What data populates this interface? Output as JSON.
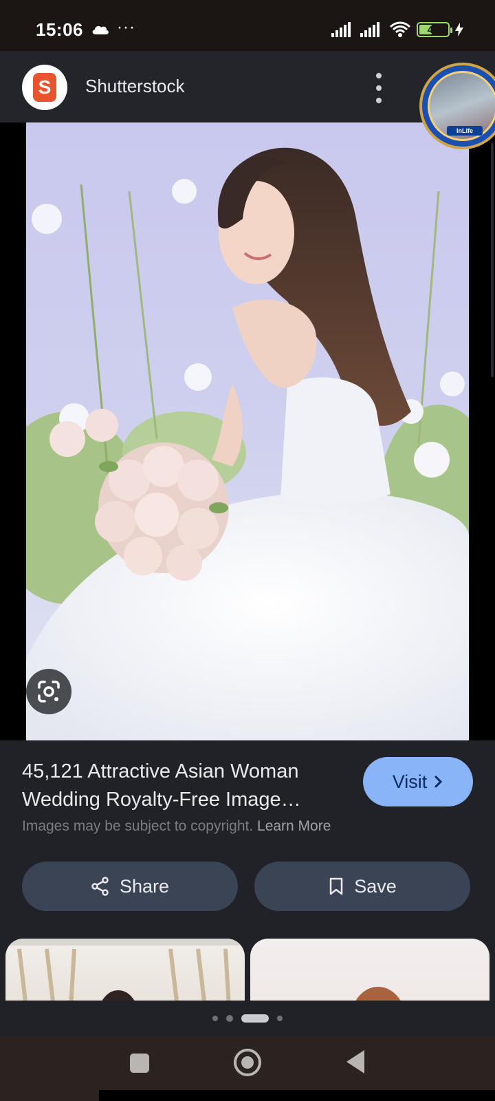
{
  "status_bar": {
    "time": "15:06",
    "more": "···",
    "battery": "42",
    "icons": [
      "cloud-icon",
      "signal-icon",
      "signal-icon",
      "wifi-icon",
      "battery-icon",
      "charging-icon"
    ]
  },
  "header": {
    "site_name": "Shutterstock",
    "logo_glyph": "S",
    "menu_icon": "more-vert-icon"
  },
  "floating_bubble": {
    "badge_text": "InLife"
  },
  "image": {
    "lens_icon": "google-lens-icon"
  },
  "result": {
    "title": "45,121 Attractive Asian Woman Wedding Royalty-Free Image…",
    "visit_label": "Visit",
    "copyright_text": "Images may be subject to copyright.",
    "learn_more_label": "Learn More",
    "share_label": "Share",
    "save_label": "Save"
  },
  "pager": {
    "dots": 4,
    "active_index": 2
  },
  "colors": {
    "accent": "#8ab4f8",
    "button_bg": "#3a4455",
    "background": "#202227",
    "shutterstock_brand": "#e8542d"
  }
}
